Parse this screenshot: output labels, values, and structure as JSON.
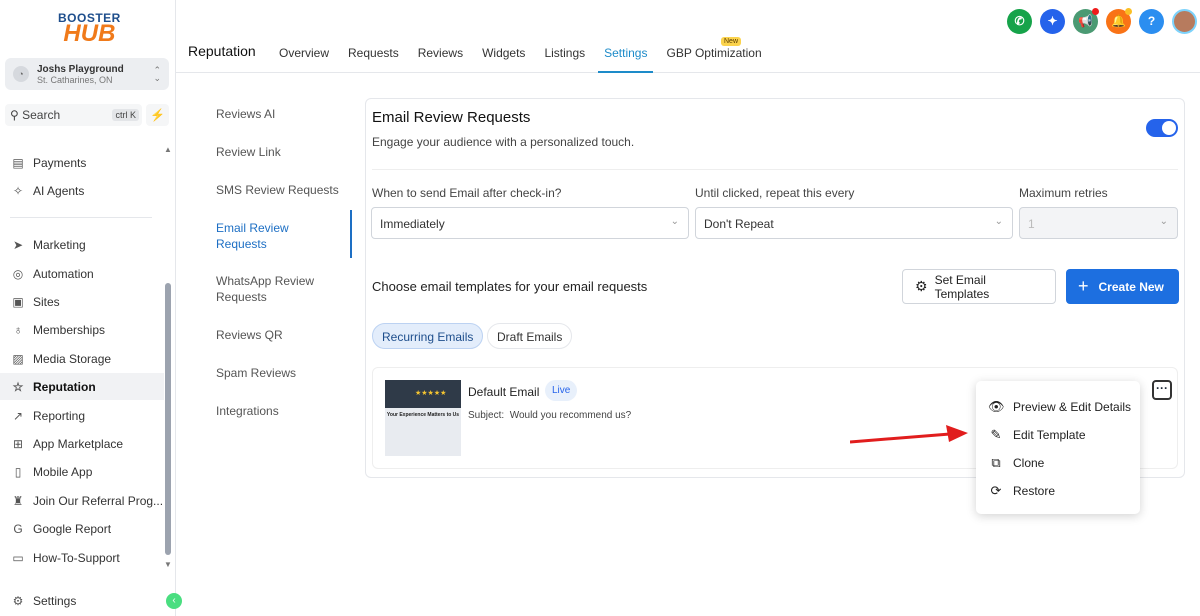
{
  "brand": {
    "line1": "BOOSTER",
    "line2": "HUB"
  },
  "account": {
    "name": "Joshs Playground",
    "location": "St. Catharines, ON"
  },
  "search": {
    "label": "Search",
    "shortcut": "ctrl K"
  },
  "sidebar": {
    "items": [
      {
        "label": "Payments",
        "icon": "payments-icon",
        "glyph": "▤"
      },
      {
        "label": "AI Agents",
        "icon": "sparkle-icon",
        "glyph": "✧"
      },
      {
        "label": "Marketing",
        "icon": "send-icon",
        "glyph": "➤"
      },
      {
        "label": "Automation",
        "icon": "automation-icon",
        "glyph": "◎"
      },
      {
        "label": "Sites",
        "icon": "sites-icon",
        "glyph": "▣"
      },
      {
        "label": "Memberships",
        "icon": "membership-icon",
        "glyph": "♁"
      },
      {
        "label": "Media Storage",
        "icon": "image-icon",
        "glyph": "▨"
      },
      {
        "label": "Reputation",
        "icon": "star-icon",
        "glyph": "☆"
      },
      {
        "label": "Reporting",
        "icon": "trend-icon",
        "glyph": "↗"
      },
      {
        "label": "App Marketplace",
        "icon": "grid-icon",
        "glyph": "⊞"
      },
      {
        "label": "Mobile App",
        "icon": "phone-icon",
        "glyph": "▯"
      },
      {
        "label": "Join Our Referral Prog...",
        "icon": "referral-icon",
        "glyph": "♜"
      },
      {
        "label": "Google Report",
        "icon": "google-icon",
        "glyph": "G"
      },
      {
        "label": "How-To-Support",
        "icon": "support-icon",
        "glyph": "▭"
      }
    ],
    "settings": "Settings"
  },
  "header": {
    "title": "Reputation",
    "tabs": [
      "Overview",
      "Requests",
      "Reviews",
      "Widgets",
      "Listings",
      "Settings",
      "GBP Optimization"
    ],
    "new_badge": "New"
  },
  "settings_nav": [
    "Reviews AI",
    "Review Link",
    "SMS Review Requests",
    "Email Review Requests",
    "WhatsApp Review Requests",
    "Reviews QR",
    "Spam Reviews",
    "Integrations"
  ],
  "card": {
    "title": "Email Review Requests",
    "subtitle": "Engage your audience with a personalized touch.",
    "enabled": true,
    "fields": [
      {
        "label": "When to send Email after check-in?",
        "value": "Immediately"
      },
      {
        "label": "Until clicked, repeat this every",
        "value": "Don't Repeat"
      },
      {
        "label": "Maximum retries",
        "value": "1"
      }
    ],
    "choose": "Choose email templates for your email requests",
    "set_templates": "Set Email Templates",
    "create_new": "Create New",
    "pills": [
      "Recurring Emails",
      "Draft Emails"
    ],
    "template": {
      "name": "Default Email",
      "status": "Live",
      "subject_label": "Subject:",
      "subject": "Would you recommend us?",
      "thumb_stars": "★★★★★",
      "thumb_title": "Your Experience Matters to Us"
    }
  },
  "menu": [
    "Preview & Edit Details",
    "Edit Template",
    "Clone",
    "Restore"
  ]
}
